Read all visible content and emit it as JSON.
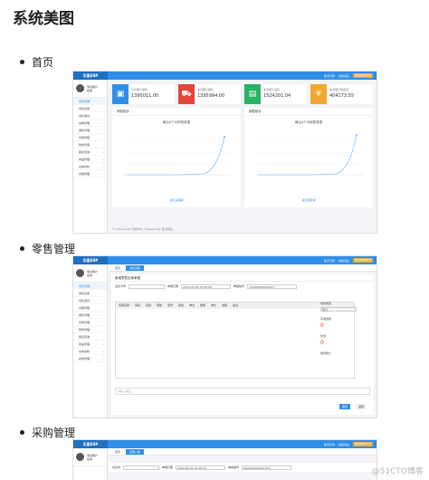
{
  "doc": {
    "title": "系统美图",
    "sections": [
      "首页",
      "零售管理",
      "采购管理"
    ]
  },
  "app": {
    "brand": "华夏ERP",
    "top_links": [
      "新手引导",
      "我的消息"
    ],
    "top_button": "极速体验模式",
    "user_name": "测试用户",
    "user_status": "在线",
    "colors": {
      "accent": "#2f8fe8",
      "blue": "#2f8fe8",
      "red": "#e0463c",
      "green": "#28b463",
      "orange": "#f0a830"
    }
  },
  "home": {
    "sidebar": [
      {
        "label": "零售管理",
        "active": true
      },
      {
        "label": "零售出库",
        "active": false
      },
      {
        "label": "零售退货",
        "active": false
      },
      {
        "label": "采购管理",
        "active": false
      },
      {
        "label": "销售管理",
        "active": false
      },
      {
        "label": "仓库管理",
        "active": false
      },
      {
        "label": "财务管理",
        "active": false
      },
      {
        "label": "报表查询",
        "active": false
      },
      {
        "label": "商品管理",
        "active": false
      },
      {
        "label": "基本资料",
        "active": false
      },
      {
        "label": "系统管理",
        "active": false
      }
    ],
    "stats": [
      {
        "label": "今日累计销售",
        "value": "1395011.00",
        "icon": "bag-icon",
        "color": "#2f8fe8"
      },
      {
        "label": "本月累计销售",
        "value": "1395994.00",
        "icon": "cart-icon",
        "color": "#e0463c"
      },
      {
        "label": "本月累计进货",
        "value": "1524201.04",
        "icon": "basket-icon",
        "color": "#28b463"
      },
      {
        "label": "本月累计现金流",
        "value": "404173.55",
        "icon": "yen-icon",
        "color": "#f0a830"
      }
    ],
    "panels": [
      {
        "head": "采购统计",
        "title": "最近6个月采购数据",
        "legend": "最近采购额"
      },
      {
        "head": "销售统计",
        "title": "最近6个月销售数据",
        "legend": "最近销售额"
      }
    ],
    "footer": "© 2015-2030 华夏ERP - Powered By 官方网站"
  },
  "retail": {
    "tabs": [
      "首页",
      "零售出库"
    ],
    "form_title": "新增零售出库单据",
    "fields": {
      "member_label": "会员卡号",
      "date_label": "单据日期",
      "date_value": "2020-05-29 15:50:00",
      "number_label": "单据编号",
      "number_value": "LSCK00000002077"
    },
    "grid_headers": [
      "仓库名称",
      "条码",
      "名称",
      "规格",
      "型号",
      "颜色",
      "单位",
      "数量",
      "单价",
      "金额",
      "备注"
    ],
    "side": {
      "pay_label": "收款类型",
      "pay_value": "现付",
      "receive_label": "实收金额",
      "receive_value": "0",
      "change_label": "找零",
      "change_value": "0",
      "account_label": "收款账户"
    },
    "note_placeholder": "请输入备注",
    "save_label": "保存",
    "return_label": "返回"
  },
  "purchase": {
    "tabs": [
      "首页",
      "采购入库"
    ],
    "supplier_label": "供应商",
    "date_label": "单据日期",
    "date_value": "2020-05-29 15:56:05",
    "number_label": "单据编号",
    "number_value": "CGRK00000001079"
  },
  "watermark": "@51CTO博客"
}
